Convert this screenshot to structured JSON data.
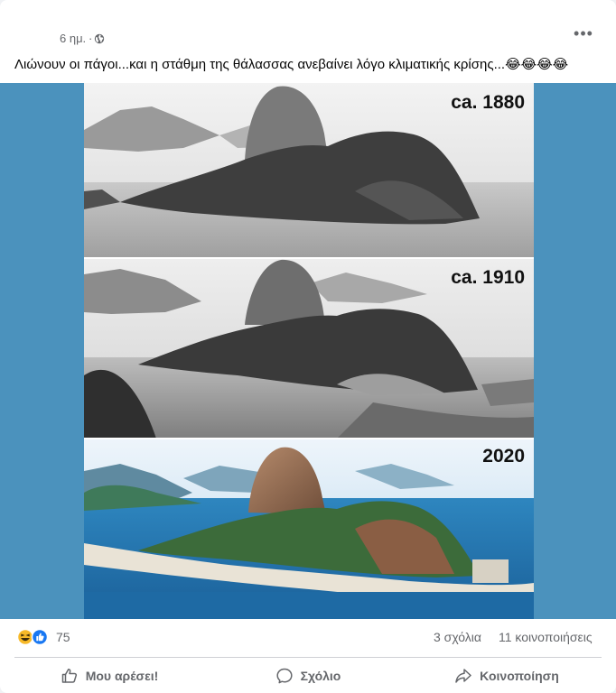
{
  "post": {
    "time": "6 ημ.",
    "separator": "·",
    "privacy_icon": "globe-icon",
    "more_icon": "more-options-icon",
    "more_label": "•••",
    "text": "Λιώνουν οι πάγοι...και η στάθμη της θάλασσας ανεβαίνει λόγο κλιματικής κρίσης...😂😂😂😂"
  },
  "image": {
    "panels": [
      {
        "label": "ca. 1880",
        "style": "grayscale"
      },
      {
        "label": "ca. 1910",
        "style": "grayscale"
      },
      {
        "label": "2020",
        "style": "color"
      }
    ],
    "side_color": "#4b92bd"
  },
  "stats": {
    "reaction_icons": [
      "haha-icon",
      "like-icon"
    ],
    "reaction_count": "75",
    "comments": "3 σχόλια",
    "shares": "11 κοινοποιήσεις"
  },
  "actions": {
    "like": "Μου αρέσει!",
    "comment": "Σχόλιο",
    "share": "Κοινοποίηση"
  },
  "colors": {
    "secondary_text": "#65676b",
    "like_blue": "#1877f2",
    "haha_yellow": "#f7b928"
  }
}
